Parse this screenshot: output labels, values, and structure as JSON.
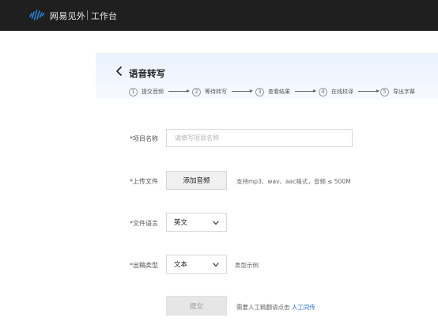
{
  "topbar": {
    "logo_icon": "wave-logo-icon",
    "brand": "网易见外",
    "workspace": "工作台"
  },
  "header": {
    "back_icon": "chevron-left-icon",
    "title": "语音转写",
    "steps": [
      {
        "num": "1",
        "label": "提交音频"
      },
      {
        "num": "2",
        "label": "等待转写"
      },
      {
        "num": "3",
        "label": "查看结果"
      },
      {
        "num": "4",
        "label": "在线校译"
      },
      {
        "num": "5",
        "label": "导出字幕"
      }
    ]
  },
  "form": {
    "project_name": {
      "label": "*项目名称",
      "value": "",
      "placeholder": "请填写项目名称"
    },
    "upload": {
      "label": "*上传文件",
      "button": "添加音频",
      "hint": "支持mp3、wav、aac格式，音频 ≤ 500M"
    },
    "language": {
      "label": "*文件语言",
      "selected": "英文"
    },
    "output_type": {
      "label": "*出稿类型",
      "selected": "文本",
      "example_link": "类型示例"
    },
    "submit": {
      "button": "提交",
      "note": "需要人工精翻请点击",
      "link": "人工同传"
    }
  },
  "colors": {
    "topbar_bg": "#1f1f1f",
    "logo_blue": "#2d8cf0",
    "header_band": "#e9f2ff",
    "link": "#2f6fd8"
  }
}
